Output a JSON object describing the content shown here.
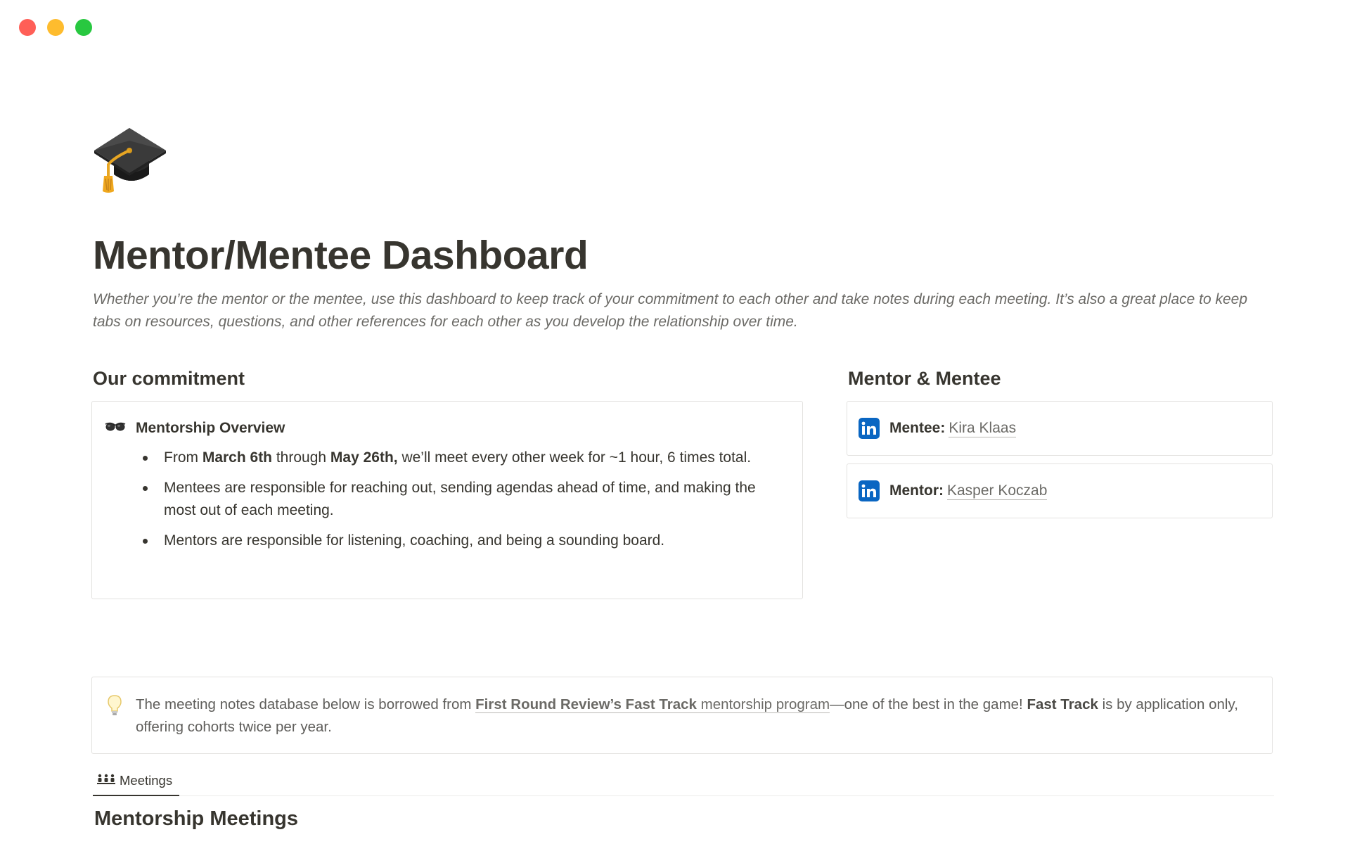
{
  "window": {
    "controls": [
      "close",
      "minimize",
      "maximize"
    ]
  },
  "page": {
    "icon": "graduation-cap-icon",
    "title": "Mentor/Mentee Dashboard",
    "description": "Whether you’re the mentor or the mentee, use this dashboard to keep track of your commitment to each other and take notes during each meeting. It’s also a great place to keep tabs on resources, questions, and other references for each other as you develop the relationship over time."
  },
  "commitment": {
    "heading": "Our commitment",
    "card_icon": "glasses-icon",
    "card_title": "Mentorship Overview",
    "item1": {
      "pre": "From ",
      "start": "March 6th",
      "mid": " through ",
      "end": "May 26th,",
      "post": " we’ll meet every other week for ~1 hour, 6 times total."
    },
    "item2": "Mentees are responsible for reaching out, sending agendas ahead of time, and making the most out of each meeting.",
    "item3": "Mentors are responsible for listening, coaching, and being a sounding board."
  },
  "people": {
    "heading": "Mentor & Mentee",
    "icon": "linkedin-icon",
    "mentee": {
      "role": "Mentee:",
      "name": "Kira Klaas"
    },
    "mentor": {
      "role": "Mentor:",
      "name": "Kasper Koczab"
    }
  },
  "callout": {
    "icon": "lightbulb-icon",
    "pre": "The meeting notes database below is borrowed from ",
    "link_bold": "First Round Review’s Fast Track",
    "link_rest": " mentorship program",
    "mid": "—one of the best in the game! ",
    "bold": "Fast Track",
    "post": " is by application only, offering cohorts twice per year."
  },
  "database": {
    "tab_icon": "people-icon",
    "tab_label": "Meetings",
    "title": "Mentorship Meetings"
  },
  "colors": {
    "text": "#37352f",
    "muted": "#6b6a66",
    "border": "#e3e2e0",
    "linkedin": "#0a66c2",
    "close": "#ff5f57",
    "minimize": "#febc2e",
    "maximize": "#28c840"
  }
}
